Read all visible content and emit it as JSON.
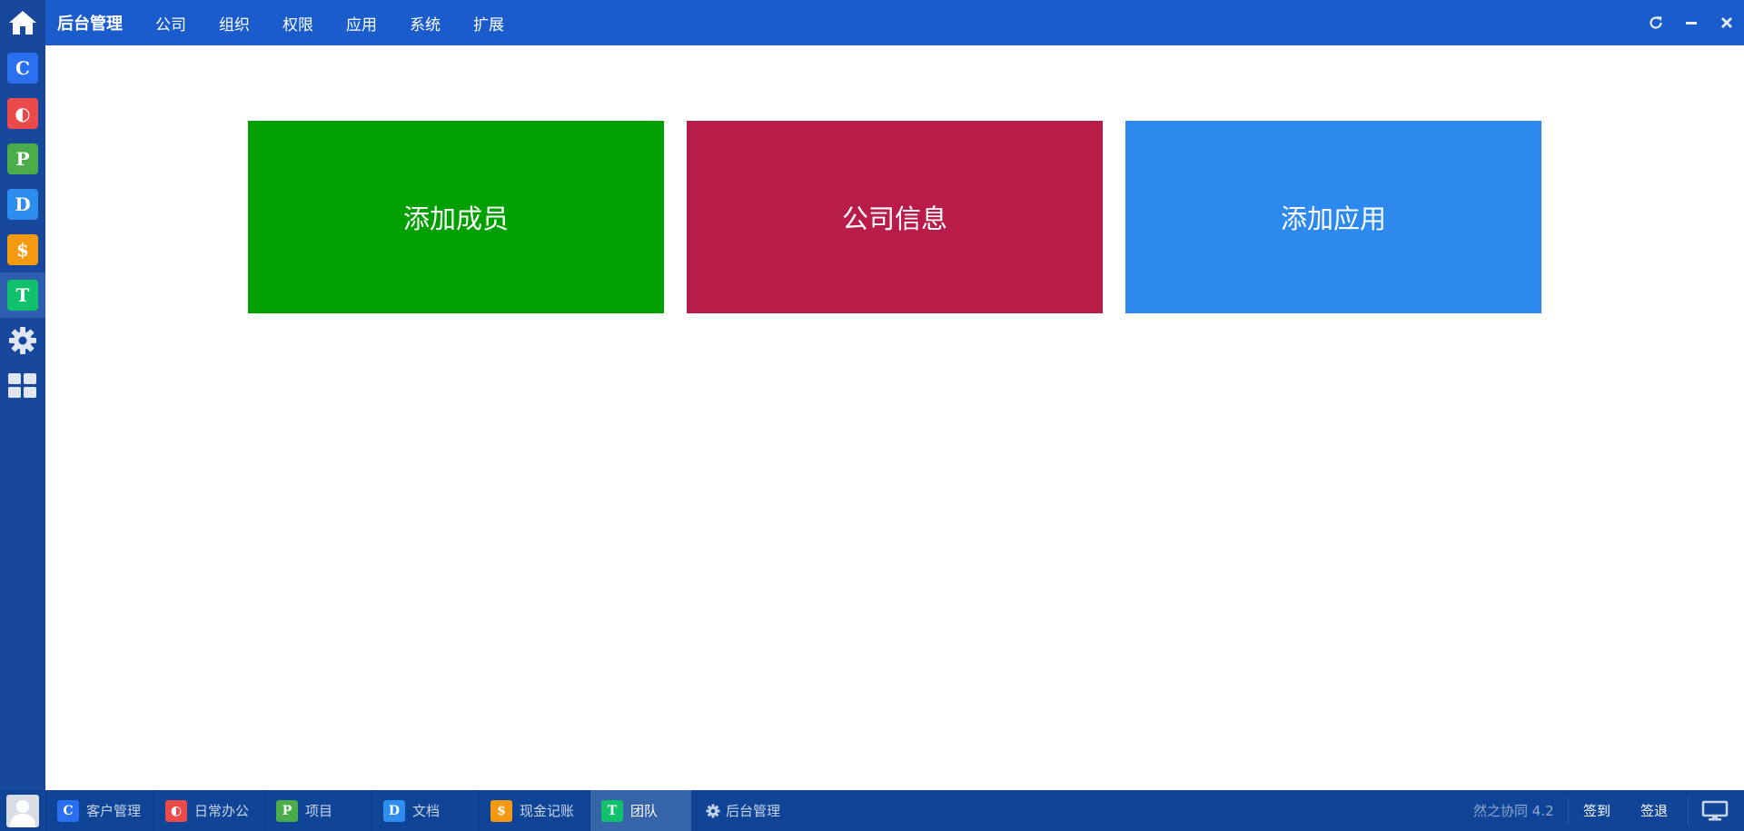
{
  "colors": {
    "sidebar_bg": "#17489b",
    "topbar_bg": "#1a5ccc",
    "taskbar_bg": "#0f4496",
    "tile_green": "#00a000",
    "tile_crimson": "#b81c48",
    "tile_blue": "#2e89ee"
  },
  "sidebar": {
    "home_icon": "home-icon",
    "apps": [
      {
        "letter": "C",
        "color": "#2a6ff0",
        "name": "customer"
      },
      {
        "letter": "◐",
        "color": "#ea4a4a",
        "name": "daily-office"
      },
      {
        "letter": "P",
        "color": "#4aad4a",
        "name": "project"
      },
      {
        "letter": "D",
        "color": "#2d8ef0",
        "name": "document"
      },
      {
        "letter": "$",
        "color": "#f39a12",
        "name": "cash"
      },
      {
        "letter": "T",
        "color": "#11c06a",
        "name": "team"
      }
    ],
    "settings_icon": "gear-icon",
    "apps_grid_icon": "grid-icon"
  },
  "topbar": {
    "brand": "后台管理",
    "menu": [
      "公司",
      "组织",
      "权限",
      "应用",
      "系统",
      "扩展"
    ],
    "refresh_icon": "refresh-icon",
    "minimize_icon": "minimize-icon",
    "close_icon": "close-icon"
  },
  "main": {
    "tiles": [
      {
        "label": "添加成员",
        "color": "#00a000"
      },
      {
        "label": "公司信息",
        "color": "#b81c48"
      },
      {
        "label": "添加应用",
        "color": "#2e89ee"
      }
    ]
  },
  "taskbar": {
    "items": [
      {
        "label": "客户管理",
        "letter": "C",
        "color": "#2a6ff0"
      },
      {
        "label": "日常办公",
        "letter": "◐",
        "color": "#ea4a4a"
      },
      {
        "label": "项目",
        "letter": "P",
        "color": "#4aad4a"
      },
      {
        "label": "文档",
        "letter": "D",
        "color": "#2d8ef0"
      },
      {
        "label": "现金记账",
        "letter": "$",
        "color": "#f39a12"
      },
      {
        "label": "团队",
        "letter": "T",
        "color": "#11c06a",
        "active": true
      },
      {
        "label": "后台管理",
        "letter": "⚙",
        "color": "transparent"
      }
    ],
    "version": "然之协同 4.2",
    "sign_in": "签到",
    "sign_out": "签退",
    "desktop_icon": "monitor-icon"
  }
}
